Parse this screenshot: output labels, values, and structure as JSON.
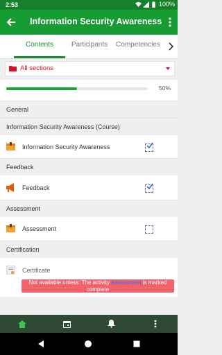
{
  "status_bar": {
    "time": "2:53",
    "battery": "100%"
  },
  "app_bar": {
    "title": "Information Security Awareness"
  },
  "tabs": [
    {
      "label": "Contents",
      "active": true
    },
    {
      "label": "Participants",
      "active": false
    },
    {
      "label": "Competencies",
      "active": false
    }
  ],
  "section_select": {
    "value": "All sections"
  },
  "progress": {
    "percent_label": "50%",
    "fraction": 0.5
  },
  "sections": {
    "general": {
      "title": "General"
    },
    "course": {
      "title": "Information Security Awareness (Course)",
      "item_label": "Information Security Awareness",
      "checked": true
    },
    "feedback": {
      "title": "Feedback",
      "item_label": "Feedback",
      "checked": true
    },
    "assessment": {
      "title": "Assessment",
      "item_label": "Assessment",
      "checked": false
    },
    "certification": {
      "title": "Certification",
      "item_label": "Certificate",
      "restriction": {
        "prefix": "Not available unless: The activity",
        "link": "Assessment",
        "suffix": "is marked complete"
      }
    }
  },
  "colors": {
    "app_bar": "#179b33",
    "accent": "#168f2f",
    "danger": "#d6112c",
    "restriction_bg": "#f2626d",
    "bottom_nav": "#2f4934"
  }
}
